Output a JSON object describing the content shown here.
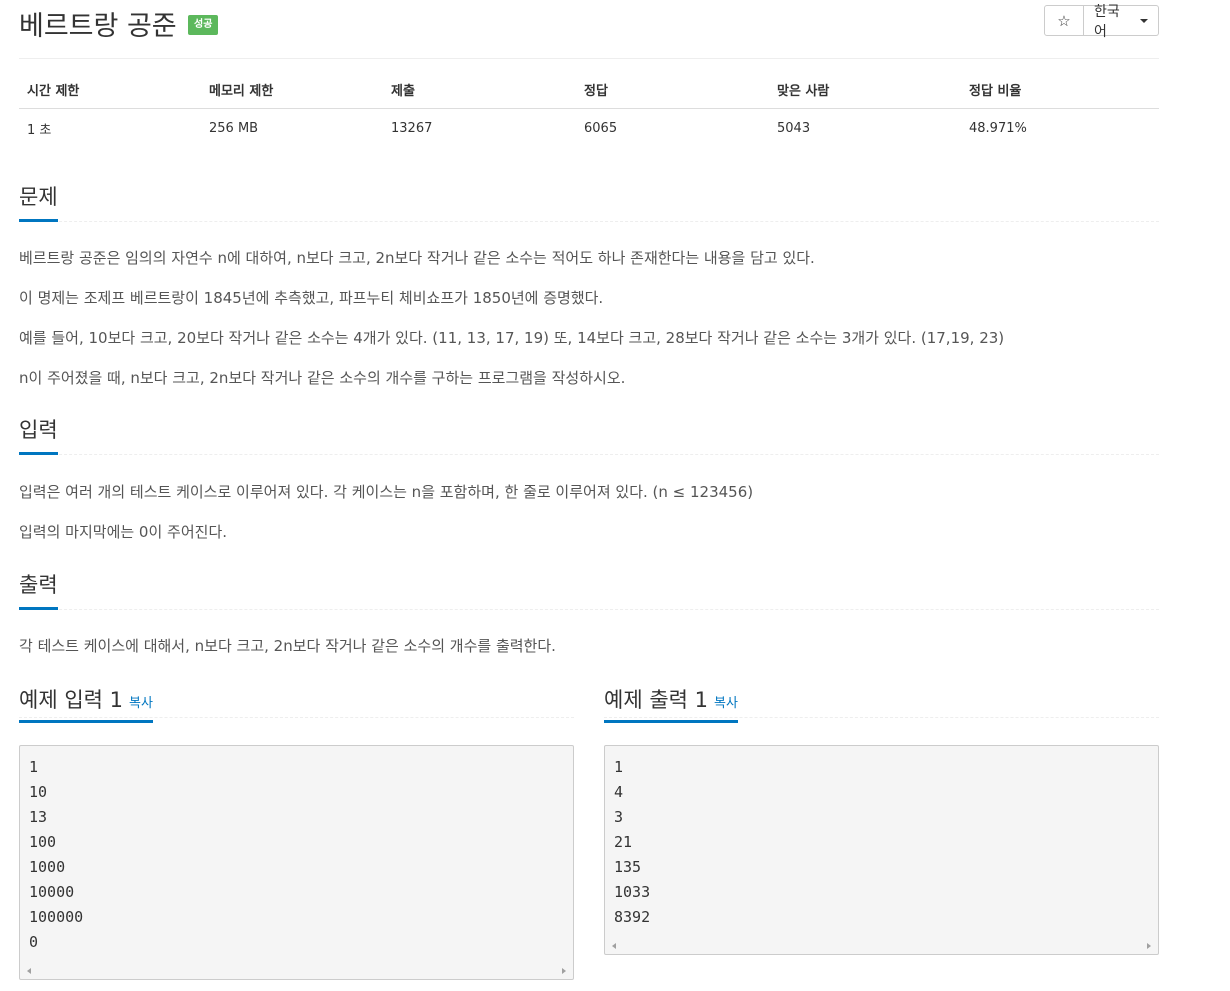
{
  "problem": {
    "title": "베르트랑 공준",
    "status_badge": "성공"
  },
  "toolbar": {
    "star_icon": "☆",
    "language": "한국어"
  },
  "info_table": {
    "headers": [
      "시간 제한",
      "메모리 제한",
      "제출",
      "정답",
      "맞은 사람",
      "정답 비율"
    ],
    "values": [
      "1 초",
      "256 MB",
      "13267",
      "6065",
      "5043",
      "48.971%"
    ]
  },
  "sections": {
    "problem": {
      "title": "문제",
      "paragraphs": [
        "베르트랑 공준은 임의의 자연수 n에 대하여, n보다 크고, 2n보다 작거나 같은 소수는 적어도 하나 존재한다는 내용을 담고 있다.",
        "이 명제는 조제프 베르트랑이 1845년에 추측했고, 파프누티 체비쇼프가 1850년에 증명했다.",
        "예를 들어, 10보다 크고, 20보다 작거나 같은 소수는 4개가 있다. (11, 13, 17, 19) 또, 14보다 크고, 28보다 작거나 같은 소수는 3개가 있다. (17,19, 23)",
        "n이 주어졌을 때, n보다 크고, 2n보다 작거나 같은 소수의 개수를 구하는 프로그램을 작성하시오."
      ]
    },
    "input": {
      "title": "입력",
      "paragraphs": [
        "입력은 여러 개의 테스트 케이스로 이루어져 있다. 각 케이스는 n을 포함하며, 한 줄로 이루어져 있다. (n ≤ 123456)",
        "입력의 마지막에는 0이 주어진다."
      ]
    },
    "output": {
      "title": "출력",
      "paragraphs": [
        "각 테스트 케이스에 대해서, n보다 크고, 2n보다 작거나 같은 소수의 개수를 출력한다."
      ]
    }
  },
  "samples": {
    "input": {
      "title": "예제 입력 1",
      "copy_label": "복사",
      "content": "1\n10\n13\n100\n1000\n10000\n100000\n0"
    },
    "output": {
      "title": "예제 출력 1",
      "copy_label": "복사",
      "content": "1\n4\n3\n21\n135\n1033\n8392"
    }
  }
}
